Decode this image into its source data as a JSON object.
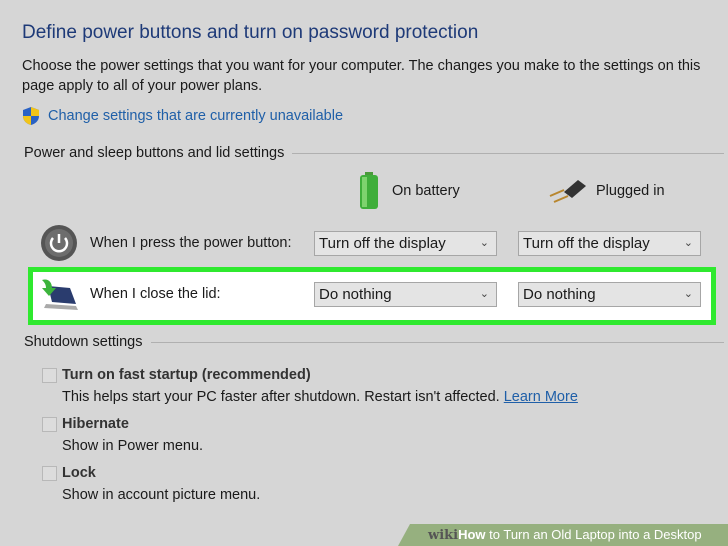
{
  "title": "Define power buttons and turn on password protection",
  "description": "Choose the power settings that you want for your computer. The changes you make to the settings on this page apply to all of your power plans.",
  "change_settings_link": "Change settings that are currently unavailable",
  "power_section": "Power and sleep buttons and lid settings",
  "columns": {
    "battery": "On battery",
    "plugged": "Plugged in"
  },
  "rows": [
    {
      "label": "When I press the power button:",
      "battery": "Turn off the display",
      "plugged": "Turn off the display"
    },
    {
      "label": "When I close the lid:",
      "battery": "Do nothing",
      "plugged": "Do nothing"
    }
  ],
  "shutdown_section": "Shutdown settings",
  "options": [
    {
      "label": "Turn on fast startup (recommended)",
      "desc": "This helps start your PC faster after shutdown. Restart isn't affected.",
      "link": "Learn More",
      "checked": false
    },
    {
      "label": "Hibernate",
      "desc": "Show in Power menu.",
      "checked": false
    },
    {
      "label": "Lock",
      "desc": "Show in account picture menu.",
      "checked": false
    }
  ],
  "watermark": {
    "brand": "wiki",
    "how": "How",
    "rest": " to Turn an Old Laptop into a Desktop"
  },
  "colors": {
    "highlight": "#2fe92f",
    "link": "#1f5fa8"
  }
}
